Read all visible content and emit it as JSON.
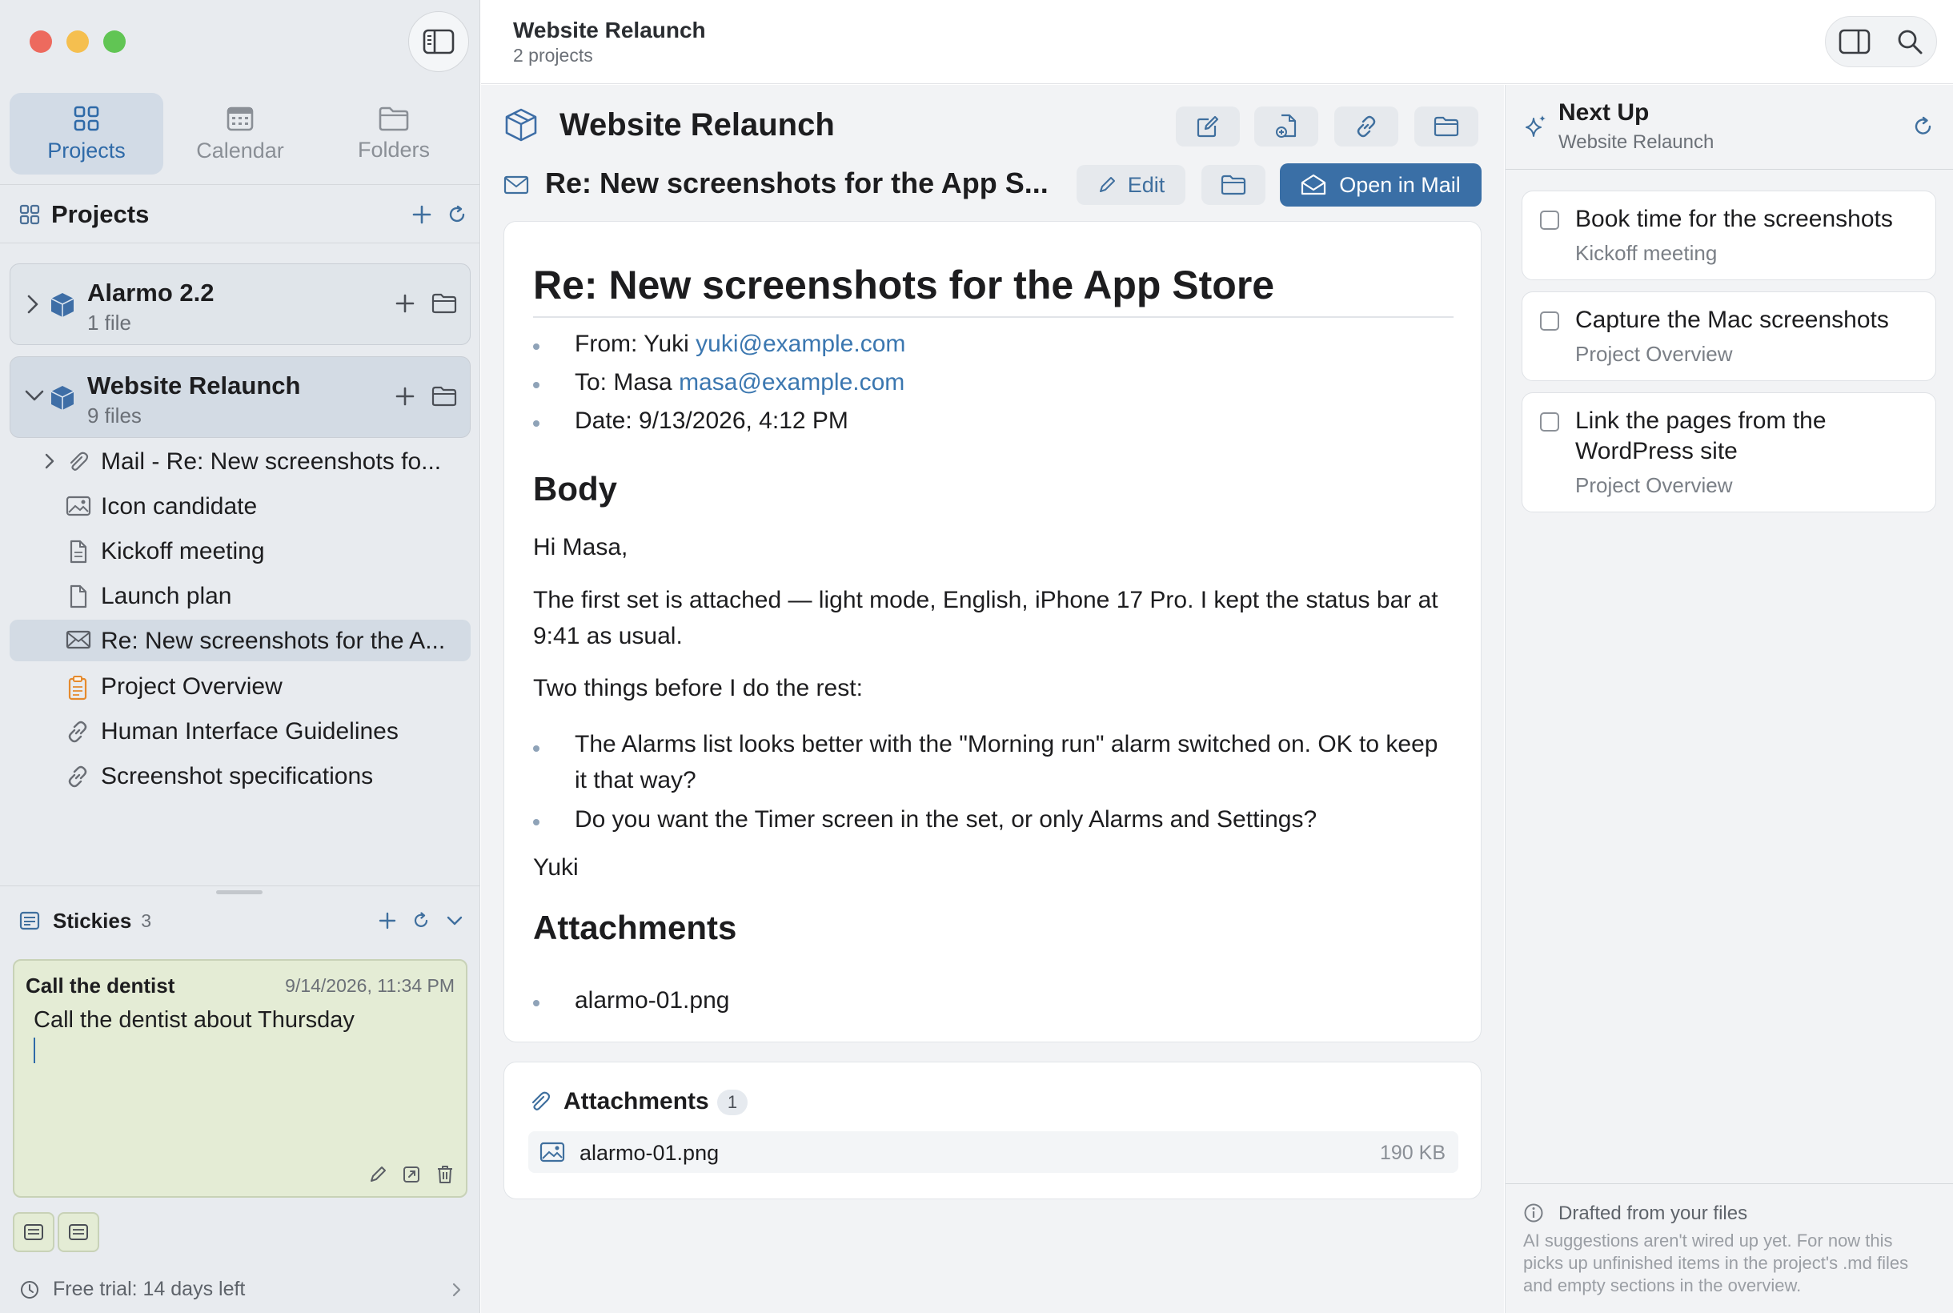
{
  "window": {
    "title": "Website Relaunch",
    "subtitle": "2 projects"
  },
  "sidebar": {
    "tabs": [
      {
        "label": "Projects",
        "icon": "grid-icon"
      },
      {
        "label": "Calendar",
        "icon": "calendar-icon"
      },
      {
        "label": "Folders",
        "icon": "folder-icon"
      }
    ],
    "section_title": "Projects",
    "projects": [
      {
        "name": "Alarmo 2.2",
        "sub": "1 file",
        "expanded": false
      },
      {
        "name": "Website Relaunch",
        "sub": "9 files",
        "expanded": true
      }
    ],
    "files": [
      {
        "label": "Mail - Re: New screenshots fo...",
        "icon": "paperclip-icon"
      },
      {
        "label": "Icon candidate",
        "icon": "image-icon"
      },
      {
        "label": "Kickoff meeting",
        "icon": "document-icon"
      },
      {
        "label": "Launch plan",
        "icon": "document-icon"
      },
      {
        "label": "Re: New screenshots for the A...",
        "icon": "envelope-icon"
      },
      {
        "label": "Project Overview",
        "icon": "clipboard-icon"
      },
      {
        "label": "Human Interface Guidelines",
        "icon": "link-icon"
      },
      {
        "label": "Screenshot specifications",
        "icon": "link-icon"
      }
    ],
    "stickies": {
      "title": "Stickies",
      "count": "3",
      "note_title": "Call the dentist",
      "note_date": "9/14/2026, 11:34 PM",
      "note_body": "Call the dentist about Thursday"
    },
    "trial": "Free trial: 14 days left"
  },
  "main": {
    "project_title": "Website Relaunch",
    "doc_title": "Re: New screenshots for the App S...",
    "edit_label": "Edit",
    "open_mail_label": "Open in Mail",
    "email": {
      "heading": "Re: New screenshots for the App Store",
      "from_label": "From: Yuki",
      "from_email": "yuki@example.com",
      "to_label": "To: Masa",
      "to_email": "masa@example.com",
      "date": "Date: 9/13/2026, 4:12 PM",
      "body_heading": "Body",
      "greeting": "Hi Masa,",
      "para1": "The first set is attached — light mode, English, iPhone 17 Pro. I kept the status bar at 9:41 as usual.",
      "para2": "Two things before I do the rest:",
      "bullet1": "The Alarms list looks better with the \"Morning run\" alarm switched on. OK to keep it that way?",
      "bullet2": "Do you want the Timer screen in the set, or only Alarms and Settings?",
      "signoff": "Yuki",
      "attach_heading": "Attachments",
      "attach_item": "alarmo-01.png"
    },
    "attachments": {
      "title": "Attachments",
      "count": "1",
      "file_name": "alarmo-01.png",
      "file_size": "190 KB"
    }
  },
  "next_up": {
    "title": "Next Up",
    "subtitle": "Website Relaunch",
    "tasks": [
      {
        "title": "Book time for the screenshots",
        "source": "Kickoff meeting"
      },
      {
        "title": "Capture the Mac screenshots",
        "source": "Project Overview"
      },
      {
        "title": "Link the pages from the WordPress site",
        "source": "Project Overview"
      }
    ],
    "footer_title": "Drafted from your files",
    "footer_text": "AI suggestions aren't wired up yet. For now this picks up unfinished items in the project's .md files and empty sections in the overview."
  },
  "colors": {
    "accent": "#2f6aa8",
    "primary_button": "#3a6fa6",
    "link": "#3b77b0",
    "sticky_bg": "#e4ecd5"
  }
}
